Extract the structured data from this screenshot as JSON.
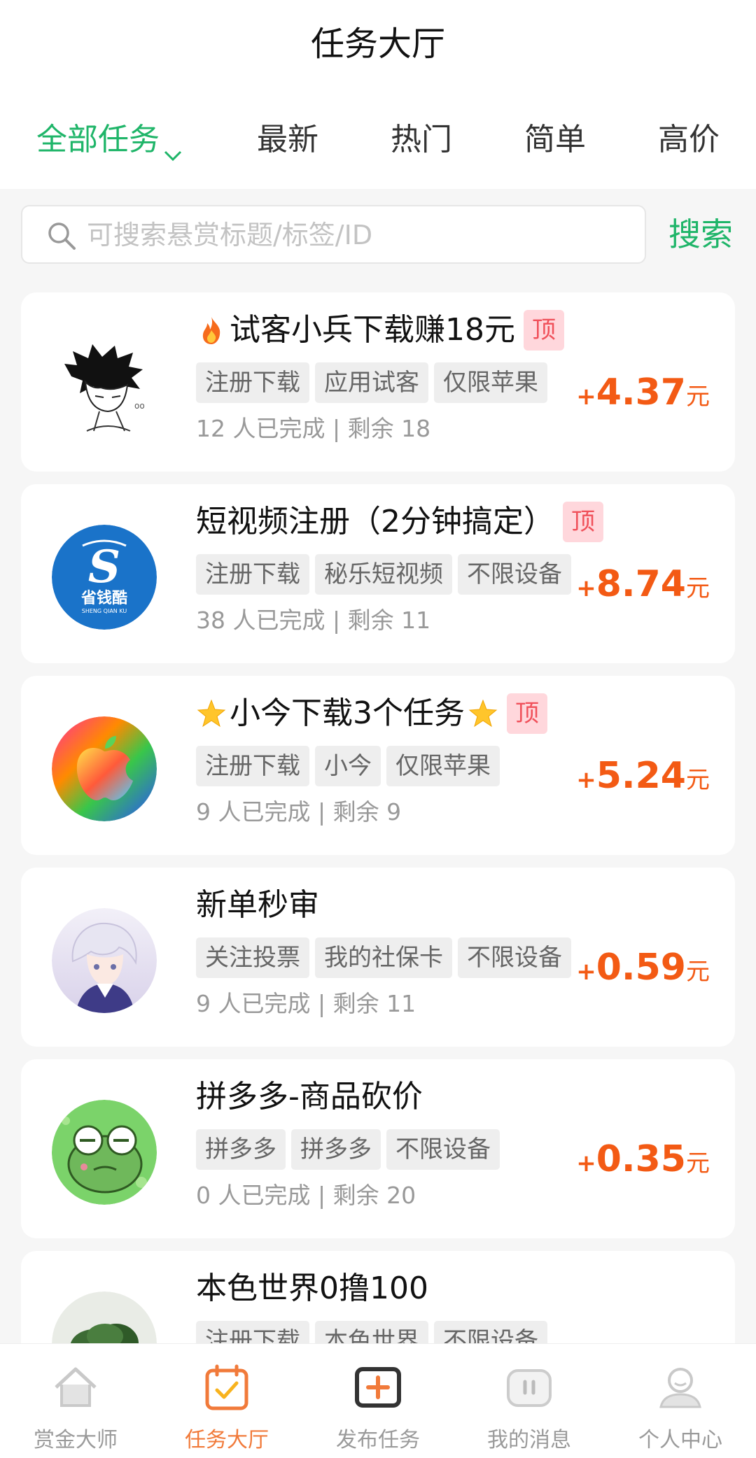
{
  "header": {
    "title": "任务大厅"
  },
  "tabs": [
    {
      "label": "全部任务"
    },
    {
      "label": "最新"
    },
    {
      "label": "热门"
    },
    {
      "label": "简单"
    },
    {
      "label": "高价"
    }
  ],
  "search": {
    "placeholder": "可搜索悬赏标题/标签/ID",
    "value": "",
    "button": "搜索"
  },
  "tasks": [
    {
      "title": "试客小兵下载赚18元",
      "badge": "顶",
      "tags": [
        "注册下载",
        "应用试客",
        "仅限苹果"
      ],
      "meta": "12 人已完成 | 剩余 18",
      "price_plus": "+",
      "price": "4.37",
      "unit": "元"
    },
    {
      "title": "短视频注册（2分钟搞定）",
      "badge": "顶",
      "tags": [
        "注册下载",
        "秘乐短视频",
        "不限设备"
      ],
      "meta": "38 人已完成 | 剩余 11",
      "price_plus": "+",
      "price": "8.74",
      "unit": "元",
      "avatar_text": "省钱酷",
      "avatar_sub": "SHENG QIAN KU"
    },
    {
      "title": "小今下载3个任务",
      "badge": "顶",
      "tags": [
        "注册下载",
        "小今",
        "仅限苹果"
      ],
      "meta": "9 人已完成 | 剩余 9",
      "price_plus": "+",
      "price": "5.24",
      "unit": "元"
    },
    {
      "title": "新单秒审",
      "tags": [
        "关注投票",
        "我的社保卡",
        "不限设备"
      ],
      "meta": "9 人已完成 | 剩余 11",
      "price_plus": "+",
      "price": "0.59",
      "unit": "元"
    },
    {
      "title": "拼多多-商品砍价",
      "tags": [
        "拼多多",
        "拼多多",
        "不限设备"
      ],
      "meta": "0 人已完成 | 剩余 20",
      "price_plus": "+",
      "price": "0.35",
      "unit": "元"
    },
    {
      "title": "本色世界0撸100",
      "tags": [
        "注册下载",
        "本色世界",
        "不限设备"
      ]
    }
  ],
  "nav": [
    {
      "label": "赏金大师",
      "icon": "home-icon"
    },
    {
      "label": "任务大厅",
      "icon": "task-hall-icon",
      "active": true
    },
    {
      "label": "发布任务",
      "icon": "publish-icon"
    },
    {
      "label": "我的消息",
      "icon": "message-icon"
    },
    {
      "label": "个人中心",
      "icon": "profile-icon"
    }
  ],
  "colors": {
    "accent_green": "#1fb569",
    "price_orange": "#f35a14",
    "badge_bg": "#ffd7dc",
    "badge_text": "#f0505a",
    "nav_active": "#f17a3a"
  }
}
